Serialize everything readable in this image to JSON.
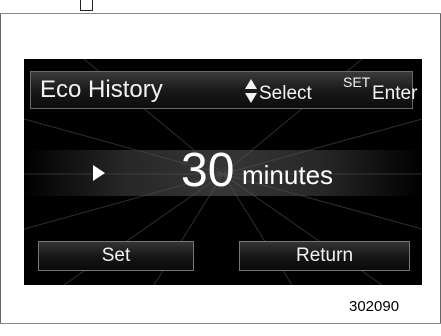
{
  "screen": {
    "title": "Eco History",
    "select_label": "Select",
    "set_label": "SET",
    "enter_label": "Enter",
    "value": "30",
    "unit": "minutes",
    "buttons": {
      "set_label": "Set",
      "return_label": "Return"
    },
    "icons": {
      "updown": "up-down-triangle-icon",
      "cursor": "play-triangle-icon"
    }
  },
  "figure_number": "302090",
  "colors": {
    "screen_background": "#000000",
    "text": "#f2f2f2",
    "border": "#777777"
  }
}
